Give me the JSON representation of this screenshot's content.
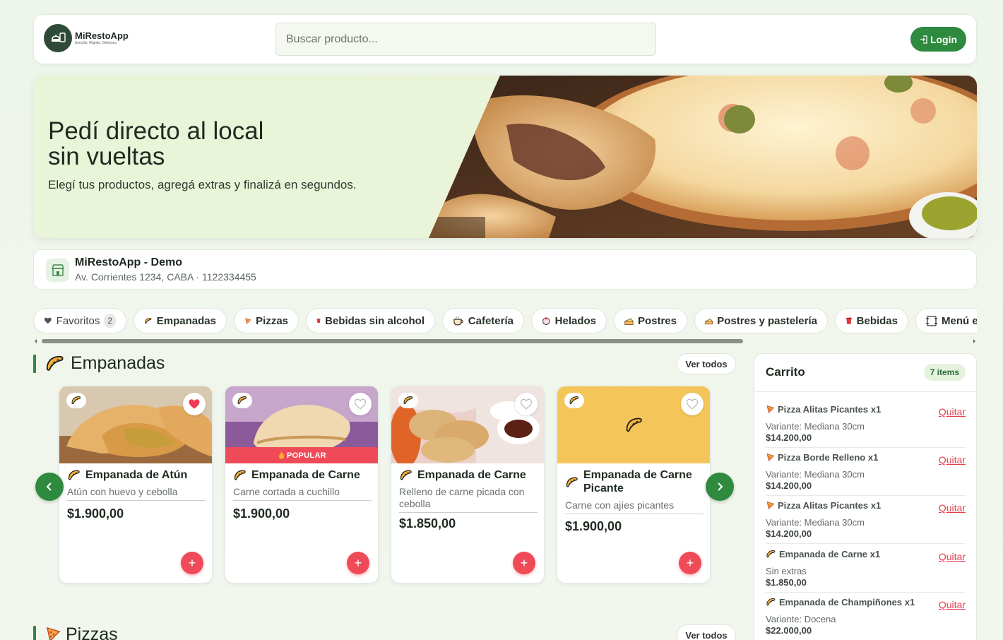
{
  "header": {
    "brand_name": "MiRestoApp",
    "brand_tagline": "Sencillo, Rápido, Delicioso",
    "search_placeholder": "Buscar producto...",
    "login_label": "Login"
  },
  "hero": {
    "title_line1": "Pedí directo al local",
    "title_line2": "sin vueltas",
    "subtitle": "Elegí tus productos, agregá extras y finalizá en segundos."
  },
  "store": {
    "name": "MiRestoApp - Demo",
    "address": "Av. Corrientes 1234, CABA · 1122334455"
  },
  "categories": [
    {
      "label": "Favoritos",
      "count": "2",
      "icon": "heart-icon"
    },
    {
      "label": "Empanadas",
      "icon": "empanada-icon"
    },
    {
      "label": "Pizzas",
      "icon": "pizza-icon"
    },
    {
      "label": "Bebidas sin alcohol",
      "icon": "cup-icon"
    },
    {
      "label": "Cafetería",
      "icon": "coffee-icon"
    },
    {
      "label": "Helados",
      "icon": "ice-cream-icon"
    },
    {
      "label": "Postres",
      "icon": "cake-icon"
    },
    {
      "label": "Postres y pastelería",
      "icon": "cake-icon"
    },
    {
      "label": "Bebidas",
      "icon": "cup-icon"
    },
    {
      "label": "Menú e",
      "icon": "menu-icon"
    }
  ],
  "sections": {
    "empanadas": {
      "title": "Empanadas",
      "ver_todos": "Ver todos"
    },
    "pizzas": {
      "title": "Pizzas",
      "ver_todos": "Ver todos"
    }
  },
  "products": [
    {
      "name": "Empanada de Atún",
      "desc": "Atún con huevo y cebolla",
      "price": "$1.900,00",
      "favorite": true,
      "popular": false
    },
    {
      "name": "Empanada de Carne",
      "desc": "Carne cortada a cuchillo",
      "price": "$1.900,00",
      "favorite": false,
      "popular": true,
      "popular_label": "POPULAR"
    },
    {
      "name": "Empanada de Carne",
      "desc": "Relleno de carne picada con cebolla",
      "price": "$1.850,00",
      "favorite": false,
      "popular": false
    },
    {
      "name": "Empanada de Carne Picante",
      "desc": "Carne con ajíes picantes",
      "price": "$1.900,00",
      "favorite": false,
      "popular": false
    }
  ],
  "cart": {
    "title": "Carrito",
    "count_label": "7 items",
    "remove_label": "Quitar",
    "items": [
      {
        "name": "Pizza Alitas Picantes x1",
        "variant": "Variante: Mediana 30cm",
        "price": "$14.200,00",
        "icon": "pizza-icon"
      },
      {
        "name": "Pizza Borde Relleno x1",
        "variant": "Variante: Mediana 30cm",
        "price": "$14.200,00",
        "icon": "pizza-icon"
      },
      {
        "name": "Pizza Alitas Picantes x1",
        "variant": "Variante: Mediana 30cm",
        "price": "$14.200,00",
        "icon": "pizza-icon"
      },
      {
        "name": "Empanada de Carne x1",
        "variant": "Sin extras",
        "price": "$1.850,00",
        "icon": "empanada-icon"
      },
      {
        "name": "Empanada de Champiñones x1",
        "variant": "Variante: Docena",
        "price": "$22.000,00",
        "icon": "empanada-icon"
      }
    ]
  },
  "colors": {
    "primary_green": "#2e8a3e",
    "accent_red": "#ef4a58",
    "hero_bg": "#eaf4d8"
  }
}
